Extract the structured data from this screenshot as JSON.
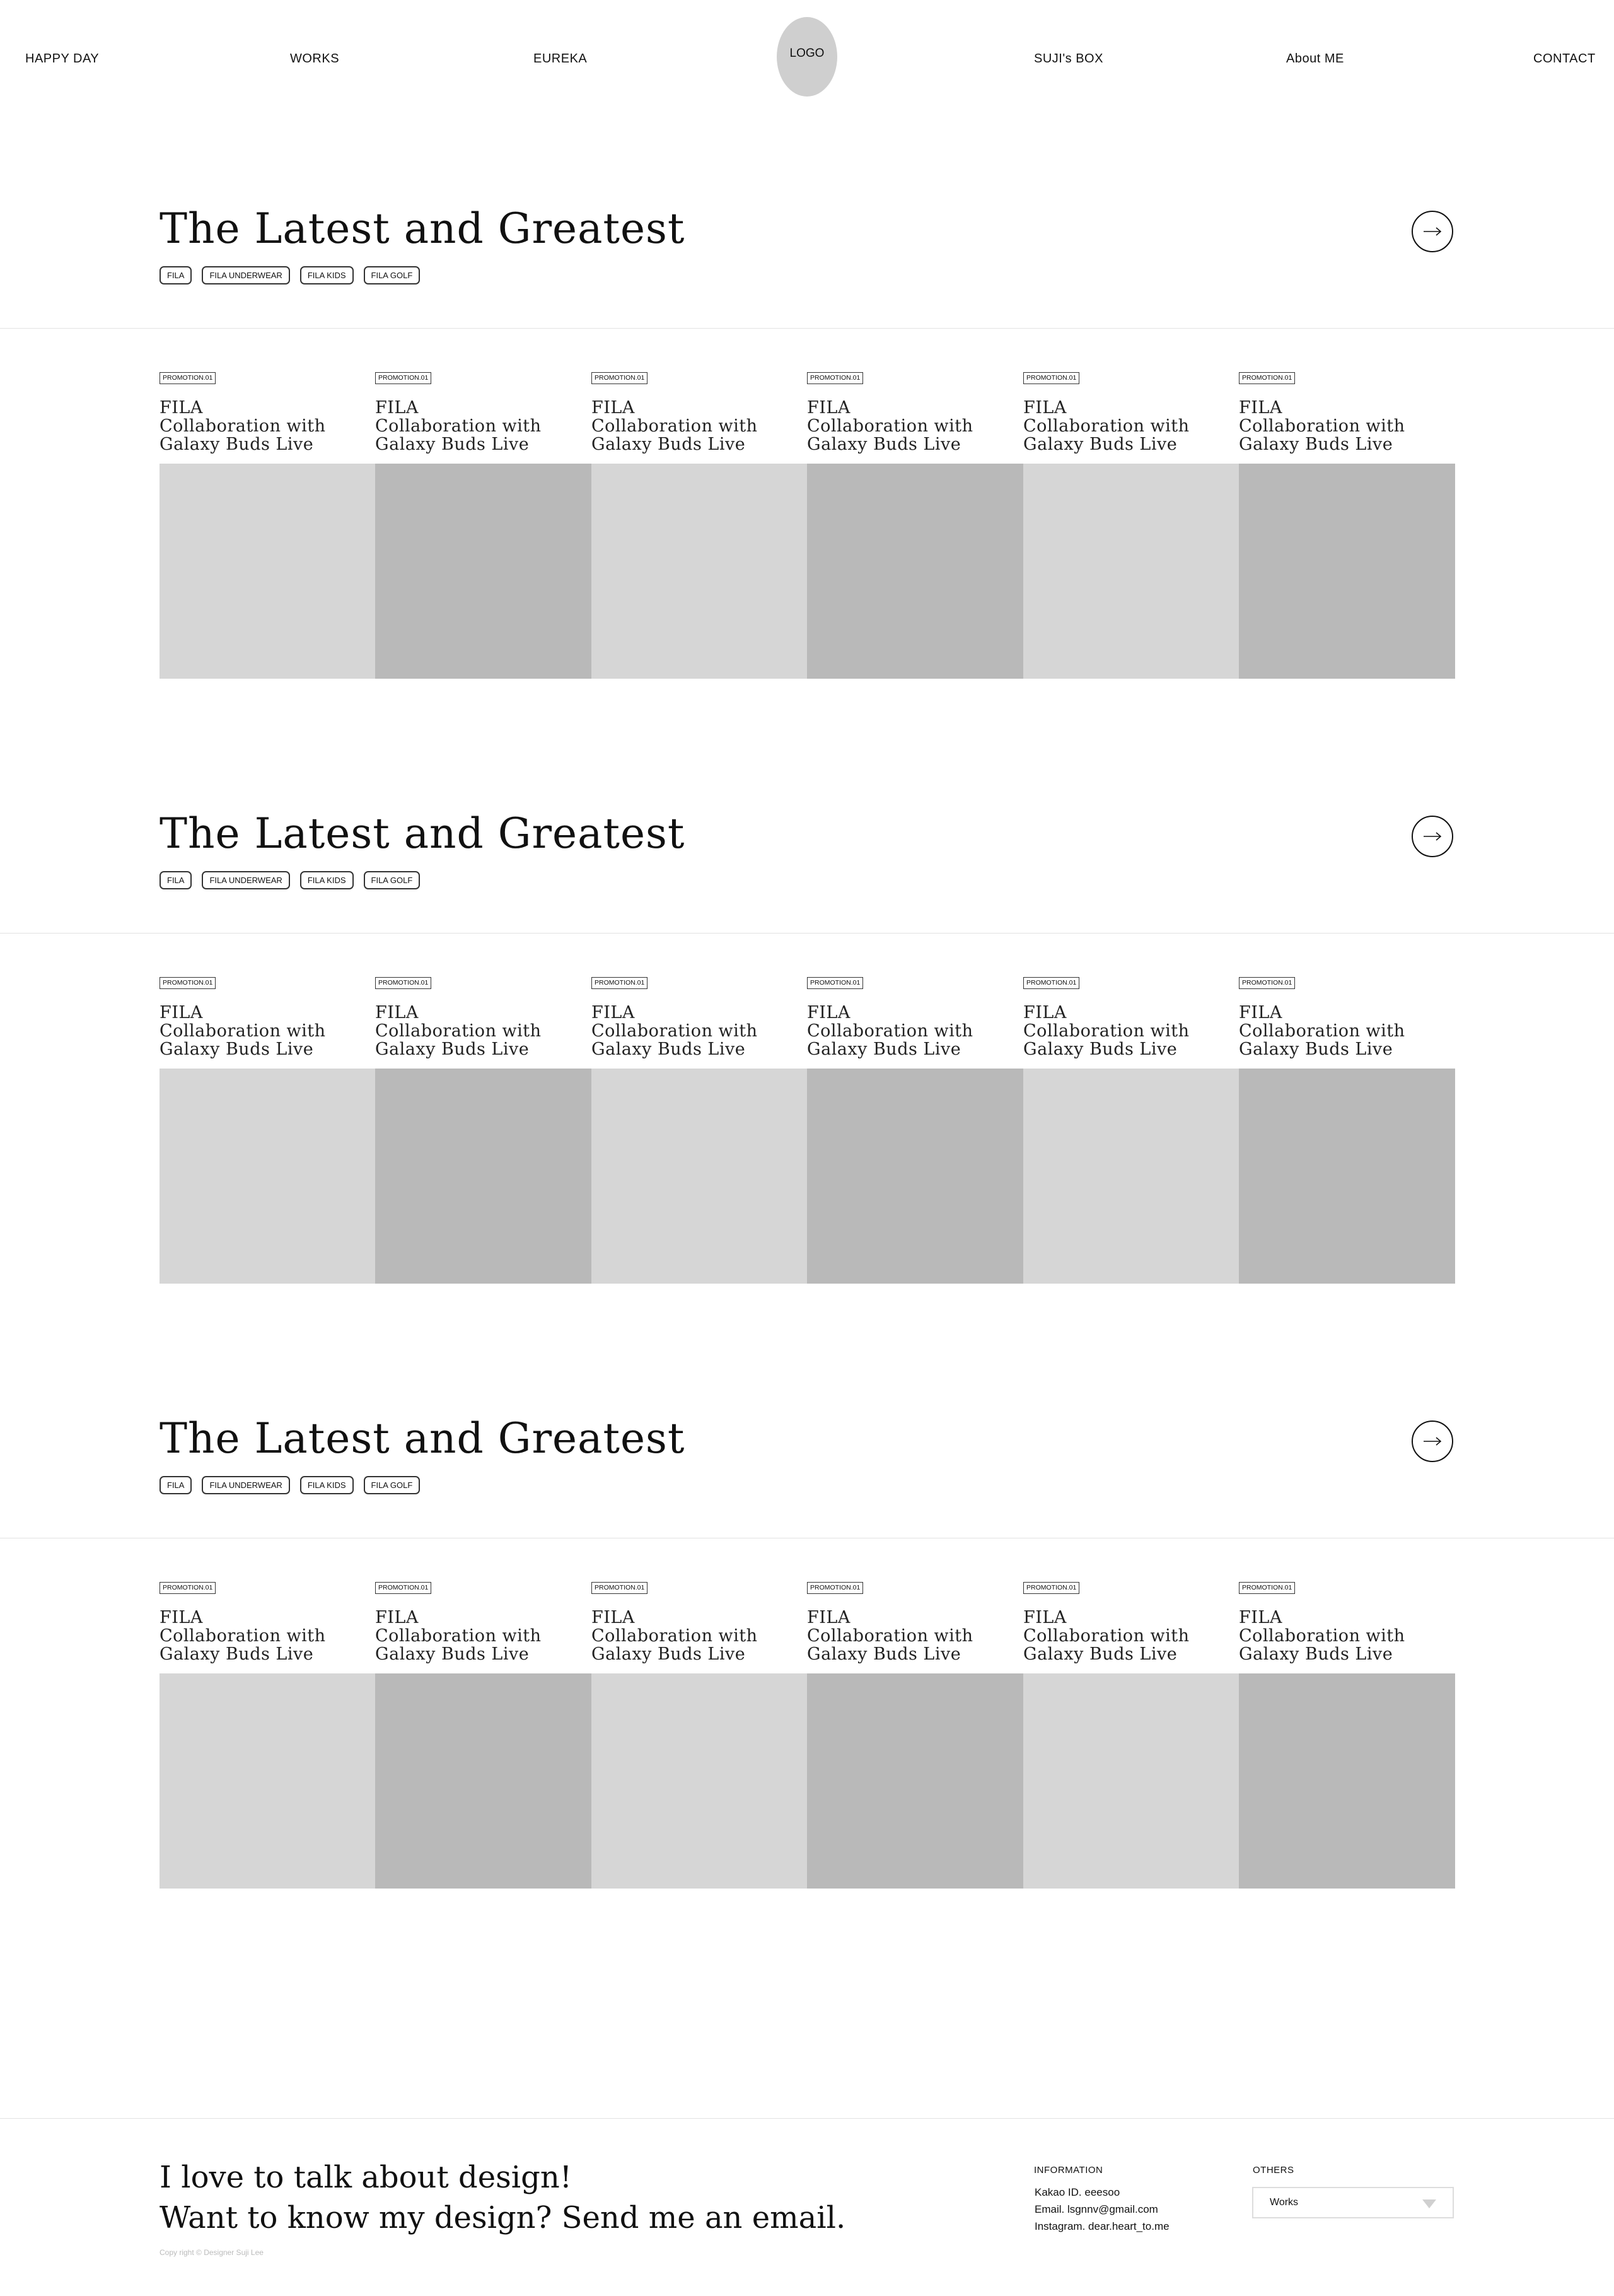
{
  "nav": {
    "items": [
      "HAPPY DAY",
      "WORKS",
      "EUREKA",
      "SUJI's BOX",
      "About ME",
      "CONTACT"
    ],
    "logo": "LOGO"
  },
  "sections": [
    {
      "title": "The Latest and Greatest",
      "tags": [
        "FILA",
        "FILA UNDERWEAR",
        "FILA KIDS",
        "FILA GOLF"
      ],
      "cards": [
        {
          "badge": "PROMOTION.01",
          "line1": "FILA",
          "line2": "Collaboration with",
          "line3": "Galaxy Buds Live"
        },
        {
          "badge": "PROMOTION.01",
          "line1": "FILA",
          "line2": "Collaboration with",
          "line3": "Galaxy Buds Live"
        },
        {
          "badge": "PROMOTION.01",
          "line1": "FILA",
          "line2": "Collaboration with",
          "line3": "Galaxy Buds Live"
        },
        {
          "badge": "PROMOTION.01",
          "line1": "FILA",
          "line2": "Collaboration with",
          "line3": "Galaxy Buds Live"
        },
        {
          "badge": "PROMOTION.01",
          "line1": "FILA",
          "line2": "Collaboration with",
          "line3": "Galaxy Buds Live"
        },
        {
          "badge": "PROMOTION.01",
          "line1": "FILA",
          "line2": "Collaboration with",
          "line3": "Galaxy Buds Live"
        }
      ]
    },
    {
      "title": "The Latest and Greatest",
      "tags": [
        "FILA",
        "FILA UNDERWEAR",
        "FILA KIDS",
        "FILA GOLF"
      ],
      "cards": [
        {
          "badge": "PROMOTION.01",
          "line1": "FILA",
          "line2": "Collaboration with",
          "line3": "Galaxy Buds Live"
        },
        {
          "badge": "PROMOTION.01",
          "line1": "FILA",
          "line2": "Collaboration with",
          "line3": "Galaxy Buds Live"
        },
        {
          "badge": "PROMOTION.01",
          "line1": "FILA",
          "line2": "Collaboration with",
          "line3": "Galaxy Buds Live"
        },
        {
          "badge": "PROMOTION.01",
          "line1": "FILA",
          "line2": "Collaboration with",
          "line3": "Galaxy Buds Live"
        },
        {
          "badge": "PROMOTION.01",
          "line1": "FILA",
          "line2": "Collaboration with",
          "line3": "Galaxy Buds Live"
        },
        {
          "badge": "PROMOTION.01",
          "line1": "FILA",
          "line2": "Collaboration with",
          "line3": "Galaxy Buds Live"
        }
      ]
    },
    {
      "title": "The Latest and Greatest",
      "tags": [
        "FILA",
        "FILA UNDERWEAR",
        "FILA KIDS",
        "FILA GOLF"
      ],
      "cards": [
        {
          "badge": "PROMOTION.01",
          "line1": "FILA",
          "line2": "Collaboration with",
          "line3": "Galaxy Buds Live"
        },
        {
          "badge": "PROMOTION.01",
          "line1": "FILA",
          "line2": "Collaboration with",
          "line3": "Galaxy Buds Live"
        },
        {
          "badge": "PROMOTION.01",
          "line1": "FILA",
          "line2": "Collaboration with",
          "line3": "Galaxy Buds Live"
        },
        {
          "badge": "PROMOTION.01",
          "line1": "FILA",
          "line2": "Collaboration with",
          "line3": "Galaxy Buds Live"
        },
        {
          "badge": "PROMOTION.01",
          "line1": "FILA",
          "line2": "Collaboration with",
          "line3": "Galaxy Buds Live"
        },
        {
          "badge": "PROMOTION.01",
          "line1": "FILA",
          "line2": "Collaboration with",
          "line3": "Galaxy Buds Live"
        }
      ]
    }
  ],
  "colors": {
    "placeholder_light": "#d6d6d6",
    "placeholder_dark": "#b9b9b9",
    "logo_bg": "#cfcfcf"
  },
  "footer": {
    "line1": "I love to talk about design!",
    "line2": "Want to know my design? Send me an email.",
    "copyright": "Copy right © Designer Suji Lee",
    "information_title": "INFORMATION",
    "kakao": "Kakao ID.  eeesoo",
    "email": "Email.  lsgnnv@gmail.com",
    "instagram": "Instagram.  dear.heart_to.me",
    "others_title": "OTHERS",
    "select_value": "Works"
  }
}
